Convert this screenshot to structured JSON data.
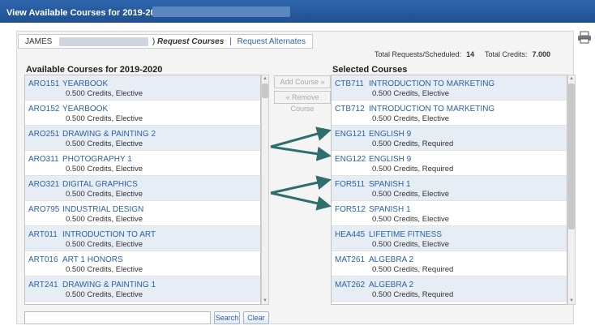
{
  "window": {
    "title": "View Available Courses for 2019-2020 in"
  },
  "tabs": {
    "student_name": "JAMES",
    "suffix": ")",
    "request_courses": "Request Courses",
    "separator": "|",
    "request_alternates": "Request Alternates"
  },
  "totals": {
    "requests_label": "Total Requests/Scheduled:",
    "requests_value": "14",
    "credits_label": "Total Credits:",
    "credits_value": "7.000"
  },
  "available": {
    "heading": "Available Courses for 2019-2020",
    "items": [
      {
        "code": "ARO151",
        "name": "YEARBOOK",
        "details": "0.500 Credits,  Elective"
      },
      {
        "code": "ARO152",
        "name": "YEARBOOK",
        "details": "0.500 Credits,  Elective"
      },
      {
        "code": "ARO251",
        "name": "DRAWING & PAINTING 2",
        "details": "0.500 Credits,  Elective"
      },
      {
        "code": "ARO311",
        "name": "PHOTOGRAPHY 1",
        "details": "0.500 Credits,  Elective"
      },
      {
        "code": "ARO321",
        "name": "DIGITAL GRAPHICS",
        "details": "0.500 Credits,  Elective"
      },
      {
        "code": "ARO795",
        "name": "INDUSTRIAL DESIGN",
        "details": "0.500 Credits,  Elective"
      },
      {
        "code": "ART011",
        "name": "INTRODUCTION TO ART",
        "details": "0.500 Credits,  Elective"
      },
      {
        "code": "ART016",
        "name": "ART 1 HONORS",
        "details": "0.500 Credits,  Elective"
      },
      {
        "code": "ART241",
        "name": "DRAWING & PAINTING 1",
        "details": "0.500 Credits,  Elective"
      }
    ]
  },
  "selected": {
    "heading": "Selected Courses",
    "items": [
      {
        "code": "CTB711",
        "name": "INTRODUCTION TO MARKETING",
        "details": "0.500 Credits,  Elective"
      },
      {
        "code": "CTB712",
        "name": "INTRODUCTION TO MARKETING",
        "details": "0.500 Credits,  Elective"
      },
      {
        "code": "ENG121",
        "name": "ENGLISH 9",
        "details": "0.500 Credits,  Required"
      },
      {
        "code": "ENG122",
        "name": "ENGLISH 9",
        "details": "0.500 Credits,  Required"
      },
      {
        "code": "FOR511",
        "name": "SPANISH 1",
        "details": "0.500 Credits,  Elective"
      },
      {
        "code": "FOR512",
        "name": "SPANISH 1",
        "details": "0.500 Credits,  Elective"
      },
      {
        "code": "HEA445",
        "name": "LIFETIME FITNESS",
        "details": "0.500 Credits,  Elective"
      },
      {
        "code": "MAT261",
        "name": "ALGEBRA 2",
        "details": "0.500 Credits,  Required"
      },
      {
        "code": "MAT262",
        "name": "ALGEBRA 2",
        "details": "0.500 Credits,  Required"
      }
    ]
  },
  "actions": {
    "add_course": "Add Course »",
    "remove_course": "« Remove Course",
    "search": "Search",
    "clear": "Clear"
  },
  "icons": {
    "print": "print-icon",
    "scroll_up": "triangle-up-icon",
    "scroll_down": "triangle-down-icon"
  },
  "colors": {
    "titlebar": "#2a5ea2",
    "link": "#2a62a8",
    "arrow": "#2e6f6e"
  }
}
